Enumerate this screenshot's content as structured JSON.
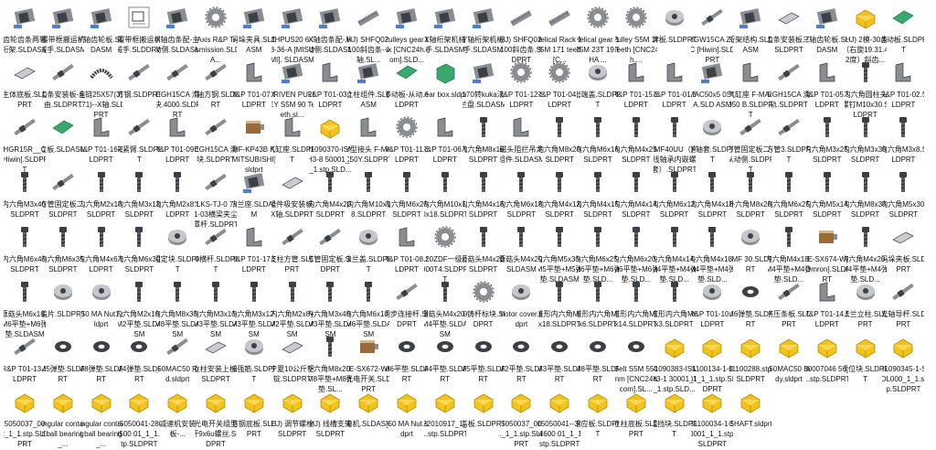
{
  "file_items": [
    {
      "label": "齿轮齿条两轴桁架.SLDASM",
      "icon": "assembly-gray-icon"
    },
    {
      "label": "履带框搬运机械手.SLDASM",
      "icon": "assembly-gray-icon"
    },
    {
      "label": "Y轴齿轮板.SLDASM",
      "icon": "assembly-gray-icon"
    },
    {
      "label": "履带框搬运机械手.SLDDRW",
      "icon": "drawing-icon"
    },
    {
      "label": "X轴齿条配-主动侧.SLDASM",
      "icon": "assembly-gray-icon"
    },
    {
      "label": "3 Axis R&P Transmission.SLDA...",
      "icon": "gear-part-icon"
    },
    {
      "label": "码垛夹具.SLDASM",
      "icon": "assembly-gray-icon"
    },
    {
      "label": "MHPUS20 6-38-36-A [MISUMI]. SLDASM",
      "icon": "assembly-gray-icon"
    },
    {
      "label": "X轴齿条配-从动侧.SLDASM",
      "icon": "assembly-gray-icon"
    },
    {
      "label": "(HJ) SHFQ020-100斜齿条--X轴.SL...",
      "icon": "rack-icon"
    },
    {
      "label": "Pulleys gear box [CNC24h.com].SLD...",
      "icon": "assembly-gray-icon"
    },
    {
      "label": "X轴桁架机械手.SLDASM",
      "icon": "assembly-gray-icon"
    },
    {
      "label": "Y轴桁架机械手.SLDASM",
      "icon": "assembly-gray-icon"
    },
    {
      "label": "(HJ) SHFQ020-100斜齿条.SLDPRT",
      "icon": "rack-icon"
    },
    {
      "label": "Helical Rack 1.25M 171 teeth [C...",
      "icon": "rack-icon"
    },
    {
      "label": "Helical gear 1.25M 23T 19.5HA ...",
      "icon": "gear-part-icon"
    },
    {
      "label": "Pulley S5M 18 Teeth [CNC24h....",
      "icon": "gear-part-icon"
    },
    {
      "label": "牌板.SLDPRT",
      "icon": "part-gray-icon"
    },
    {
      "label": "HGW15CA ZOC [Hiwin].SLDPRT",
      "icon": "rail-icon"
    },
    {
      "label": "桁架结构.SLDASM",
      "icon": "assembly-gray-icon"
    },
    {
      "label": "齿条安装板三.SLDPRT",
      "icon": "plate-icon"
    },
    {
      "label": "Z轴齿轮板.SLDASM",
      "icon": "assembly-gray-icon"
    },
    {
      "label": "(HJ) 2模-30齿（右旋19.31.42度）斜齿...",
      "icon": "yellow-part-icon"
    },
    {
      "label": "移动板.SLDPRT",
      "icon": "plate-green-icon"
    },
    {
      "label": "主体底板.SLDPRT",
      "icon": "plate-icon"
    },
    {
      "label": "齿条安装板-自由.SLDPRT",
      "icon": "rail-icon"
    },
    {
      "label": "拖链25X57(35X71)--X轴.SLDPRT",
      "icon": "chain-icon"
    },
    {
      "label": "方钢.SLDPRT",
      "icon": "rail-icon"
    },
    {
      "label": "EGH15CA 滑块.4000.SLDPRT",
      "icon": "rail-icon"
    },
    {
      "label": "Y轴方钢.SLDPRT",
      "icon": "rail-icon"
    },
    {
      "label": "R&P T01-07.SLDPRT",
      "icon": "bracket-icon"
    },
    {
      "label": "DRIVEN PULLEY S5M 90 Teeth.sl...",
      "icon": "assembly-gray-icon"
    },
    {
      "label": "R&P T01-03.SLDPRT",
      "icon": "bracket-icon"
    },
    {
      "label": "立柱组件.SLDASM",
      "icon": "assembly-gray-icon"
    },
    {
      "label": "移动板-从动.SLDPRT",
      "icon": "plate-green-icon"
    },
    {
      "label": "gear box.sldprt",
      "icon": "box-icon"
    },
    {
      "label": "170转kuka法兰盘.SLDASM",
      "icon": "assembly-gray-icon"
    },
    {
      "label": "R&P T01-12.SLDPRT",
      "icon": "gear-part-icon"
    },
    {
      "label": "R&P T01-04.SLDPRT",
      "icon": "gear-part-icon"
    },
    {
      "label": "上端盖.SLDPRT",
      "icon": "part-gray-icon"
    },
    {
      "label": "R&P T01-15.SLDPRT",
      "icon": "bracket-icon"
    },
    {
      "label": "R&P T01-01.SLDPRT",
      "icon": "bracket-icon"
    },
    {
      "label": "MAC50x5 0SCA.SLD ASM",
      "icon": "assembly-gray-icon"
    },
    {
      "label": "气缸座 F-MA4050 B.SLDPRT",
      "icon": "bracket-icon"
    },
    {
      "label": "EGH15CA 滑轨.SLDPRT",
      "icon": "rail-icon"
    },
    {
      "label": "R&P T01-05.SLDPRT",
      "icon": "bracket-icon"
    },
    {
      "label": "内六角圆柱头螺钉M10x30.SLDPRT",
      "icon": "screw-icon"
    },
    {
      "label": "R&P T01-02.SLDPRT",
      "icon": "bracket-icon"
    },
    {
      "label": "HGR15R__C [Hiwin].SLDPRT",
      "icon": "rail-icon"
    },
    {
      "label": "立板.SLDASM",
      "icon": "plate-green-icon"
    },
    {
      "label": "R&P T01-16.SLDPRT",
      "icon": "bracket-icon"
    },
    {
      "label": "夹紧臂.SLDPRT",
      "icon": "rail-icon"
    },
    {
      "label": "R&P T01-09.SLDPRT",
      "icon": "bracket-icon"
    },
    {
      "label": "EGH15CA 滑块.SLDPRT",
      "icon": "rail-icon"
    },
    {
      "label": "HF-KP43B K[MITSUBISHI].sldprt",
      "icon": "motor-icon"
    },
    {
      "label": "气缸座.SLDPRT",
      "icon": "bracket-icon"
    },
    {
      "label": "31090370-ISMH3-8 50001_1_1.stp.SLD...",
      "icon": "yellow-part-icon"
    },
    {
      "label": "Y型接头 F-MAC50Y.SLDPRT",
      "icon": "bracket-icon"
    },
    {
      "label": "R&P T01-11.SLDPRT",
      "icon": "gear-part-icon"
    },
    {
      "label": "R&P T01-06.SLDPRT",
      "icon": "bracket-icon"
    },
    {
      "label": "内六角M8x16.SLDPRT",
      "icon": "screw-icon"
    },
    {
      "label": "磁头阻拦吊龙组件.SLDASM",
      "icon": "bracket-icon"
    },
    {
      "label": "内六角M8x20.SLDPRT",
      "icon": "screw-icon"
    },
    {
      "label": "内六角M6x16.SLDPRT",
      "icon": "screw-icon"
    },
    {
      "label": "内六角M4x25.SLDPRT",
      "icon": "screw-icon"
    },
    {
      "label": "LMF40UU（直线轴承内嵌螺套）.SLDPRT",
      "icon": "screw-icon"
    },
    {
      "label": "下轴套.SLDPRT",
      "icon": "part-gray-icon"
    },
    {
      "label": "方管固定板二--从动侧.SLDPRT",
      "icon": "rail-icon"
    },
    {
      "label": "方管3.SLDPRT",
      "icon": "rail-icon"
    },
    {
      "label": "内六角M3x25.SLDPRT",
      "icon": "screw-icon"
    },
    {
      "label": "内六角M3x30.SLDPRT",
      "icon": "screw-icon"
    },
    {
      "label": "内六角M3x8.SLDPRT",
      "icon": "screw-icon"
    },
    {
      "label": "内六角M3x40.SLDPRT",
      "icon": "screw-icon"
    },
    {
      "label": "方管固定板二.SLDPRT",
      "icon": "rail-icon"
    },
    {
      "label": "内六角M2x10.SLDPRT",
      "icon": "screw-icon"
    },
    {
      "label": "内六角M3x12.SLDPRT",
      "icon": "screw-icon"
    },
    {
      "label": "内六角M2x8.SLDPRT",
      "icon": "screw-icon"
    },
    {
      "label": "YLKS-TJ-0 7-01-03横梁夹尘罩杆.SLDPRT",
      "icon": "rail-icon"
    },
    {
      "label": "法兰座.SLDASM",
      "icon": "assembly-gray-icon"
    },
    {
      "label": "组件吸安装板-X轴.SLDPRT",
      "icon": "plate-icon"
    },
    {
      "label": "内六角M4x20.SLDPRT",
      "icon": "screw-icon"
    },
    {
      "label": "内六角M10x18.SLDPRT",
      "icon": "screw-icon"
    },
    {
      "label": "内六角M6x20.SLDPRT",
      "icon": "screw-icon"
    },
    {
      "label": "内六角M10x1.0x18.SLDPRT",
      "icon": "screw-icon"
    },
    {
      "label": "内六角M4x16.SLDPRT",
      "icon": "screw-icon"
    },
    {
      "label": "内六角M6x18.SLDPRT",
      "icon": "screw-icon"
    },
    {
      "label": "内六角M4x12.SLDPRT",
      "icon": "screw-icon"
    },
    {
      "label": "内六角M4x15.SLDPRT",
      "icon": "screw-icon"
    },
    {
      "label": "内六角M4x14.SLDPRT",
      "icon": "screw-icon"
    },
    {
      "label": "内六角M6x12.SLDPRT",
      "icon": "screw-icon"
    },
    {
      "label": "内六角M4x18.SLDPRT",
      "icon": "screw-icon"
    },
    {
      "label": "外六角M8x20.SLDPRT",
      "icon": "screw-icon"
    },
    {
      "label": "内六角M6x25.SLDPRT",
      "icon": "screw-icon"
    },
    {
      "label": "内六角M5x14.SLDPRT",
      "icon": "screw-icon"
    },
    {
      "label": "内六角M8x30.SLDPRT",
      "icon": "screw-icon"
    },
    {
      "label": "内六角M5x30.SLDPRT",
      "icon": "screw-icon"
    },
    {
      "label": "内六角M6x40.SLDPRT",
      "icon": "screw-icon"
    },
    {
      "label": "内六角M6x35.SLDPRT",
      "icon": "screw-icon"
    },
    {
      "label": "内六角M4x6.SLDPRT",
      "icon": "screw-icon"
    },
    {
      "label": "内六角M6x30.SLDPRT",
      "icon": "screw-icon"
    },
    {
      "label": "固定块.SLDPRT",
      "icon": "part-gray-icon"
    },
    {
      "label": "30横杆.SLDPRT",
      "icon": "rail-icon"
    },
    {
      "label": "R&P T01-17.SLDPRT",
      "icon": "bracket-icon"
    },
    {
      "label": "支柱方管.SLDPRT",
      "icon": "rail-icon"
    },
    {
      "label": "方管固定板.SLDPRT",
      "icon": "rail-icon"
    },
    {
      "label": "法兰盖.SLDPRT",
      "icon": "part-gray-icon"
    },
    {
      "label": "R&P T01-08.SLDPRT",
      "icon": "bracket-icon"
    },
    {
      "label": "120ZDF一级-1000T4.SLDPRT",
      "icon": "gear-part-icon"
    },
    {
      "label": "蘑菇头M4x20.SLDPRT",
      "icon": "screw-icon"
    },
    {
      "label": "蘑菇头M4x20.SLDASM",
      "icon": "screw-icon"
    },
    {
      "label": "内六角M5x30+M5平垫+M5弹垫.SLDASM",
      "icon": "screw-icon"
    },
    {
      "label": "内六角M6x25+M6平垫+M6弹垫.SLD...",
      "icon": "screw-icon"
    },
    {
      "label": "内六角M6x20+M6平垫+M6弹垫.SLD...",
      "icon": "screw-icon"
    },
    {
      "label": "内六角M4x14+M4平垫+M4弹垫.SLD...",
      "icon": "screw-icon"
    },
    {
      "label": "内六角M4x18+M4平垫+M4弹垫.SLD...",
      "icon": "screw-icon"
    },
    {
      "label": "LMF 30.SLDPRT",
      "icon": "part-gray-icon"
    },
    {
      "label": "内六角M4x18+M4平垫+M4弹垫.SLD...",
      "icon": "screw-icon"
    },
    {
      "label": "EE-SX674-WR [Omron].SLDPRT",
      "icon": "motor-icon"
    },
    {
      "label": "内六角M4x20+M4平垫+M4弹垫.SLD...",
      "icon": "screw-icon"
    },
    {
      "label": "码垛夹板.SLDPRT",
      "icon": "plate-icon"
    },
    {
      "label": "蘑菇头M6x16+M6平垫+M6弹垫.SLDASM",
      "icon": "screw-icon"
    },
    {
      "label": "盖片.SLDPRT",
      "icon": "part-gray-icon"
    },
    {
      "label": "_50 MA Nut1.sldprt",
      "icon": "part-gray-icon"
    },
    {
      "label": "内六角M2x10+M2平垫.SLDASM",
      "icon": "screw-icon"
    },
    {
      "label": "内六角M8x30+M8平垫.SLDASM",
      "icon": "screw-icon"
    },
    {
      "label": "内六角M3x10+M3平垫.SLDASM",
      "icon": "screw-icon"
    },
    {
      "label": "内六角M3x12+M3平垫.SLDASM",
      "icon": "screw-icon"
    },
    {
      "label": "内六角M2x8+M2平垫.SLDASM",
      "icon": "screw-icon"
    },
    {
      "label": "内六角M3x40+M3平垫.SLDASM",
      "icon": "screw-icon"
    },
    {
      "label": "内六角M6x18+M6平垫.SLDASM",
      "icon": "screw-icon"
    },
    {
      "label": "同步连接杆.SLDPRT",
      "icon": "rail-icon"
    },
    {
      "label": "蘑菇头M4x20+M4平垫.SLDASM",
      "icon": "screw-icon"
    },
    {
      "label": "30铸杆标块.SLDPRT",
      "icon": "gear-part-icon"
    },
    {
      "label": "motor cover.sldprt",
      "icon": "part-gray-icon"
    },
    {
      "label": "锥形内六角M6x18.SLDPRT",
      "icon": "screw-icon"
    },
    {
      "label": "锥形内六角M5x6.SLDPRT",
      "icon": "screw-icon"
    },
    {
      "label": "锥形内六角M5x14.SLDPRT",
      "icon": "screw-icon"
    },
    {
      "label": "锥形内六角M6x3.SLDPRT",
      "icon": "screw-icon"
    },
    {
      "label": "R&P T01-10.SLDPRT",
      "icon": "part-gray-icon"
    },
    {
      "label": "M6弹垫.SLDPRT",
      "icon": "washer-icon"
    },
    {
      "label": "挤压条板.SLDPRT",
      "icon": "rail-icon"
    },
    {
      "label": "R&P T01-14.SLDPRT",
      "icon": "bracket-icon"
    },
    {
      "label": "法兰立柱.SLDPRT",
      "icon": "part-gray-icon"
    },
    {
      "label": "光轴导杆.SLDPRT",
      "icon": "rail-icon"
    },
    {
      "label": "R&P T01-13.SLDPRT",
      "icon": "rail-icon"
    },
    {
      "label": "M5弹垫.SLDPRT",
      "icon": "washer-icon"
    },
    {
      "label": "M8弹垫.SLDPRT",
      "icon": "washer-icon"
    },
    {
      "label": "M4弹垫.SLDPRT",
      "icon": "washer-icon"
    },
    {
      "label": "_50MAC50 Rod.sldprt",
      "icon": "rail-icon"
    },
    {
      "label": "立柱安装上板.SLDPRT",
      "icon": "plate-icon"
    },
    {
      "label": "加强筋.SLDPRT",
      "icon": "part-gray-icon"
    },
    {
      "label": "宁夏10公斤铝锭.SLDPRT",
      "icon": "plate-icon"
    },
    {
      "label": "外六角M8x20+M8平垫+M8弹垫.SL...",
      "icon": "screw-icon"
    },
    {
      "label": "EE-SX672-WR 光电开关.SLDPRT",
      "icon": "motor-icon"
    },
    {
      "label": "M6平垫.SLDPRT",
      "icon": "washer-icon"
    },
    {
      "label": "M4平垫.SLDPRT",
      "icon": "washer-icon"
    },
    {
      "label": "M5平垫.SLDPRT",
      "icon": "washer-icon"
    },
    {
      "label": "M2平垫.SLDPRT",
      "icon": "washer-icon"
    },
    {
      "label": "M3平垫.SLDPRT",
      "icon": "washer-icon"
    },
    {
      "label": "M8平垫.SLDPRT",
      "icon": "washer-icon"
    },
    {
      "label": "Belt S5M 550mm [CNC24h.com].SL...",
      "icon": "washer-icon"
    },
    {
      "label": "31090383-ISMH3-1 30001_1_1.stp.SLD...",
      "icon": "yellow-part-icon"
    },
    {
      "label": "31100134-1-0001_1_1.stp.SLDPRT",
      "icon": "yellow-part-icon"
    },
    {
      "label": "31100288.stp.SLDPRT",
      "icon": "yellow-part-icon"
    },
    {
      "label": "_50MAC50 Body.sldprt",
      "icon": "yellow-part-icon"
    },
    {
      "label": "00007046 56_1.stp.SLDPRT",
      "icon": "yellow-part-icon"
    },
    {
      "label": "限位块.SLDPRT",
      "icon": "yellow-part-icon"
    },
    {
      "label": "31090345-1-SOL000_1_1.stp.SLDPRT",
      "icon": "yellow-part-icon"
    },
    {
      "label": "15050037_0002_1_1.stp.SLDPRT",
      "icon": "yellow-part-icon"
    },
    {
      "label": "angular contact ball bearing_...",
      "icon": "yellow-part-icon"
    },
    {
      "label": "angular contact ball bearing_...",
      "icon": "yellow-part-icon"
    },
    {
      "label": "15050041-2809500 01_1_1.stp.SLDPRT",
      "icon": "yellow-part-icon"
    },
    {
      "label": "减速机安装板-...",
      "icon": "yellow-part-icon"
    },
    {
      "label": "光电开关组型杆9x6u螺丝.SLDPRT",
      "icon": "yellow-part-icon"
    },
    {
      "label": "方钢底板.SLDPRT",
      "icon": "yellow-part-icon"
    },
    {
      "label": "(HJ) 调节螺栓.SLDPRT",
      "icon": "yellow-part-icon"
    },
    {
      "label": "(HJ) 线槽支架.SLDPRT",
      "icon": "yellow-part-icon"
    },
    {
      "label": "电机.SLDASM",
      "icon": "yellow-part-icon"
    },
    {
      "label": "_50 MA Nut.sldprt",
      "icon": "yellow-part-icon"
    },
    {
      "label": "22010917_1_1.stp.SLDPRT",
      "icon": "yellow-part-icon"
    },
    {
      "label": "盖板.SLDPRT",
      "icon": "yellow-part-icon"
    },
    {
      "label": "15050037_0001_1_1.stp.SLDPRT",
      "icon": "yellow-part-icon"
    },
    {
      "label": "15050041--3404600 01_1_1.stp.SLDPRT",
      "icon": "yellow-part-icon"
    },
    {
      "label": "感应板.SLDPRT",
      "icon": "yellow-part-icon"
    },
    {
      "label": "立柱底板.SLDPRT",
      "icon": "yellow-part-icon"
    },
    {
      "label": "阻挡块.SLDPRT",
      "icon": "yellow-part-icon"
    },
    {
      "label": "31100034-1-S0001_1_1.stp.SLDPRT",
      "icon": "yellow-part-icon"
    },
    {
      "label": "SHAFT.sldprt",
      "icon": "yellow-part-icon"
    }
  ],
  "colors": {
    "label": "#111111",
    "part_gray": "#8a8d92",
    "part_dark": "#3b3f46",
    "yellow": "#f2c31b",
    "green": "#3aa76d",
    "background": "#ffffff"
  }
}
